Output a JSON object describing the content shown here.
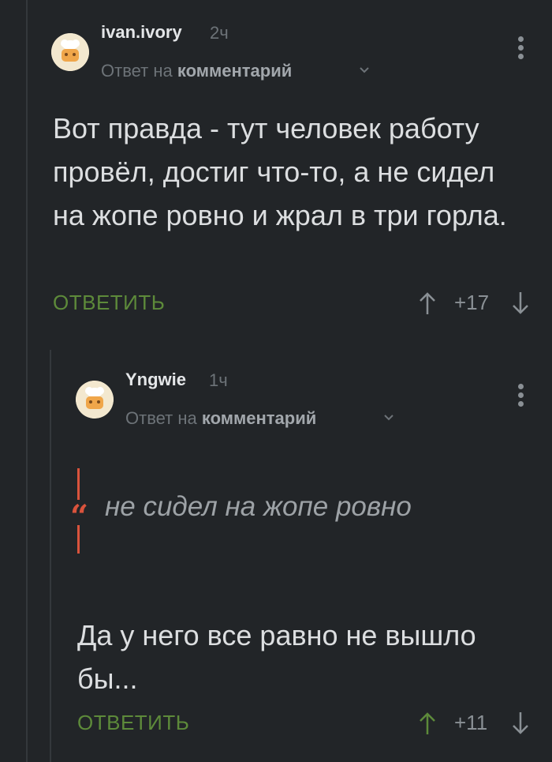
{
  "comments": [
    {
      "username": "ivan.ivory",
      "time": "2ч",
      "reply_prefix": "Ответ на",
      "reply_target": "комментарий",
      "text": "Вот правда - тут человек работу провёл, достиг что-то, а не сидел на жопе ровно и жрал в три горла.",
      "reply_label": "ОТВЕТИТЬ",
      "score": "+17"
    },
    {
      "username": "Yngwie",
      "time": "1ч",
      "reply_prefix": "Ответ на",
      "reply_target": "комментарий",
      "quote": "не сидел на жопе ровно",
      "text": "Да у него все равно не вышло бы...",
      "reply_label": "ОТВЕТИТЬ",
      "score": "+11"
    }
  ],
  "colors": {
    "background": "#222528",
    "accent_green": "#5d8a3a",
    "quote_red": "#d9533c"
  },
  "icons": [
    "avatar",
    "chevron-down-icon",
    "more-vert-icon",
    "arrow-up-icon",
    "arrow-down-icon",
    "quote-icon"
  ]
}
